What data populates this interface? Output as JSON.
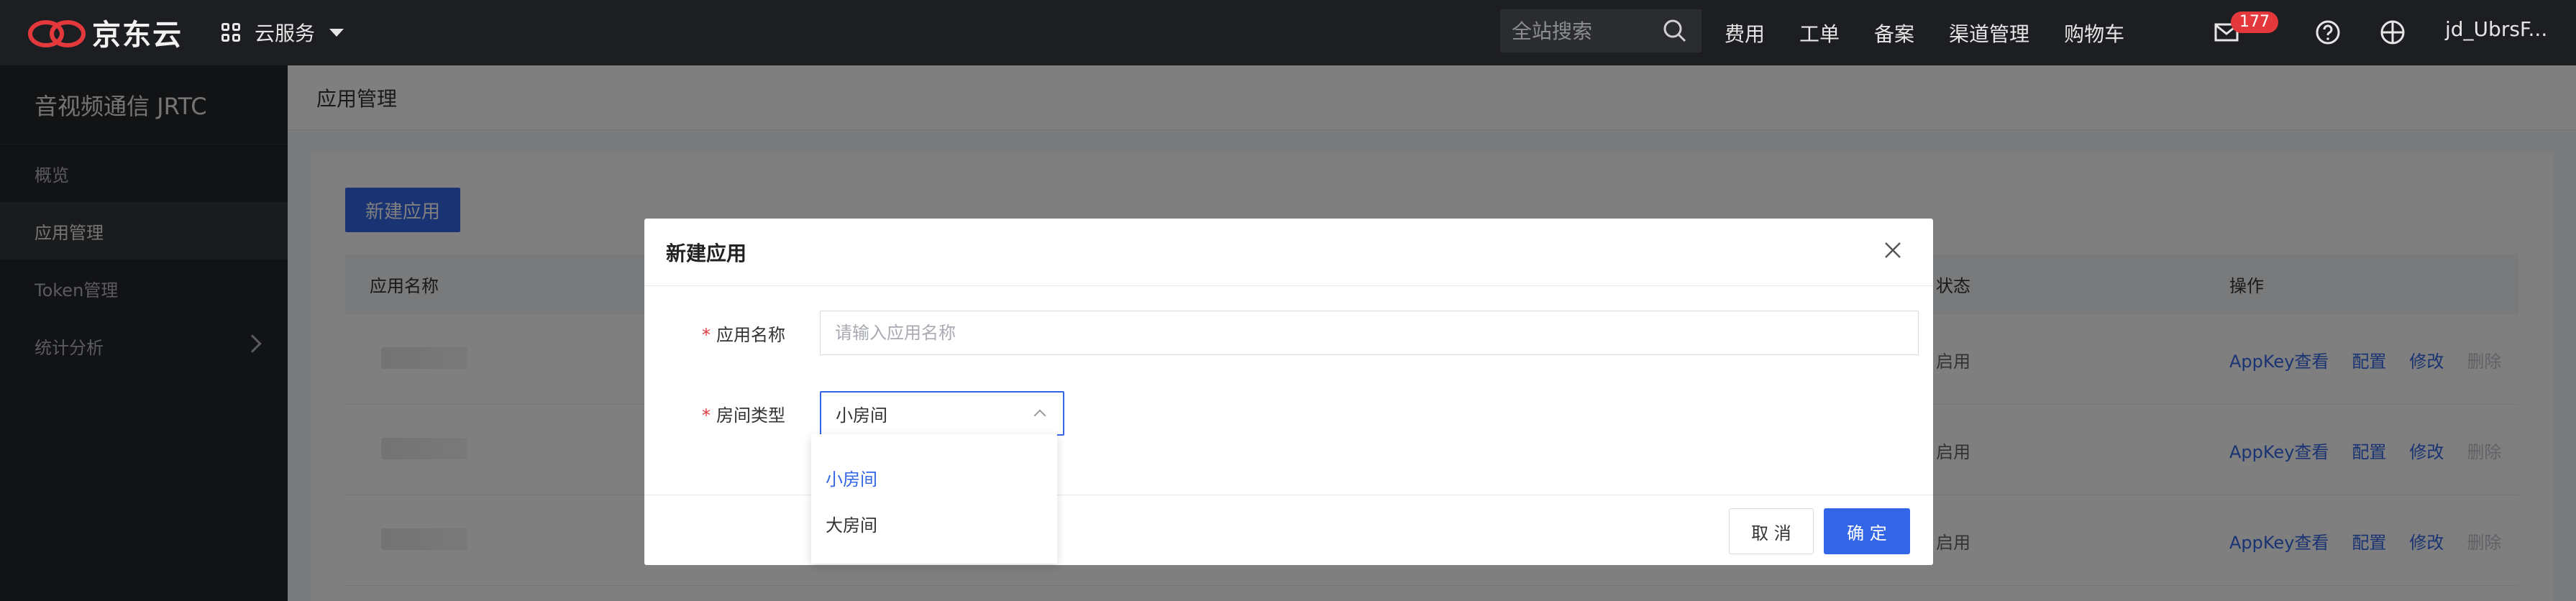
{
  "topbar": {
    "brand": "京东云",
    "services_label": "云服务",
    "search_placeholder": "全站搜索",
    "links": [
      "费用",
      "工单",
      "备案",
      "渠道管理",
      "购物车"
    ],
    "mail_badge": "177",
    "user": "jd_UbrsF..."
  },
  "sidebar": {
    "title": "音视频通信 JRTC",
    "items": [
      "概览",
      "应用管理",
      "Token管理",
      "统计分析"
    ]
  },
  "main": {
    "page_title": "应用管理",
    "new_button": "新建应用",
    "table": {
      "headers": {
        "name": "应用名称",
        "status": "状态",
        "ops": "操作"
      },
      "rows": [
        {
          "status": "启用",
          "ops": [
            "AppKey查看",
            "配置",
            "修改",
            "删除"
          ]
        },
        {
          "status": "启用",
          "ops": [
            "AppKey查看",
            "配置",
            "修改",
            "删除"
          ]
        },
        {
          "status": "启用",
          "ops": [
            "AppKey查看",
            "配置",
            "修改",
            "删除"
          ]
        }
      ]
    }
  },
  "modal": {
    "title": "新建应用",
    "name_label": "应用名称",
    "name_placeholder": "请输入应用名称",
    "room_label": "房间类型",
    "room_value": "小房间",
    "room_options": [
      "小房间",
      "大房间"
    ],
    "cancel": "取 消",
    "ok": "确 定"
  },
  "colors": {
    "primary": "#3366e6",
    "brand_red": "#e4393c",
    "topbar_bg": "#1d1e21",
    "sidebar_bg": "#25272b"
  }
}
